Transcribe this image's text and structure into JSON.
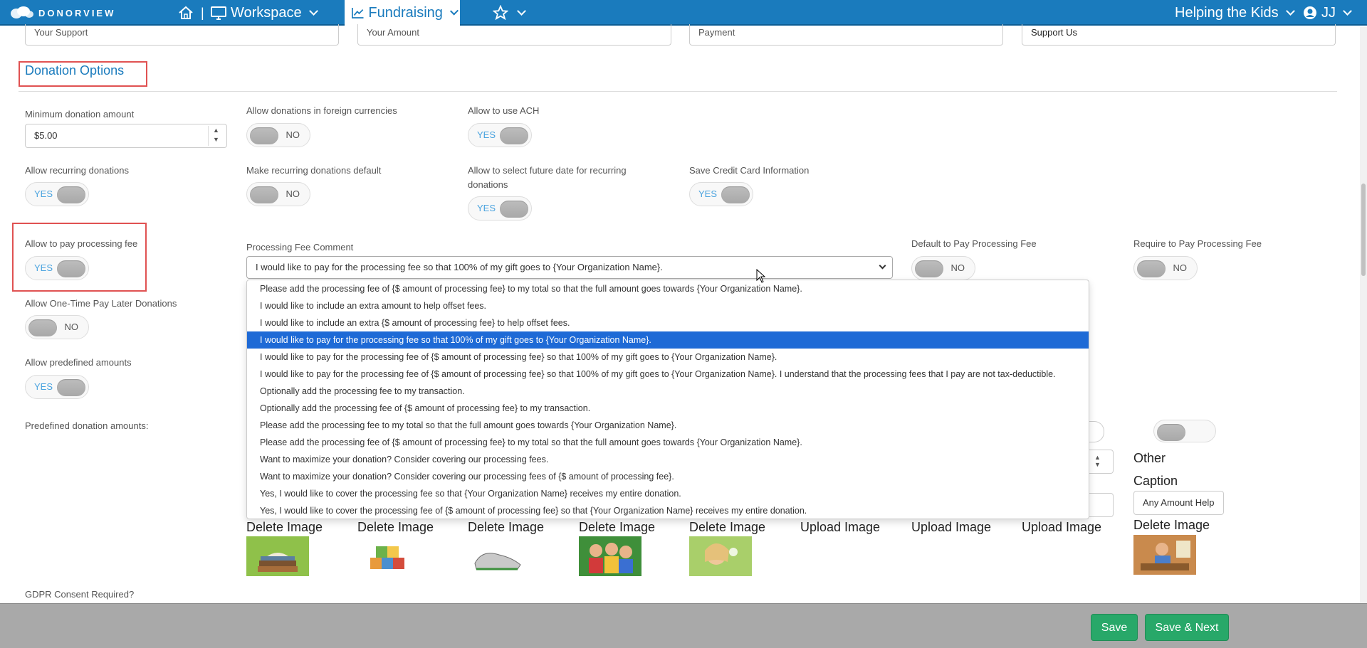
{
  "topbar": {
    "logo": "DONORVIEW",
    "nav_sep": "|",
    "workspace": "Workspace",
    "fundraising": "Fundraising",
    "org": "Helping the Kids",
    "user": "JJ"
  },
  "top_fields": [
    "Your Support",
    "Your Amount",
    "Payment",
    "Support Us"
  ],
  "section_title": "Donation Options",
  "fields": {
    "min_amount_label": "Minimum donation amount",
    "min_amount_value": "$5.00",
    "foreign_currency_label": "Allow donations in foreign currencies",
    "ach_label": "Allow to use ACH",
    "recurring_label": "Allow recurring donations",
    "recurring_default_label": "Make recurring donations default",
    "future_date_label": "Allow to select future date for recurring donations",
    "save_cc_label": "Save Credit Card Information",
    "processing_fee_label": "Allow to pay processing fee",
    "fee_comment_label": "Processing Fee Comment",
    "default_fee_label": "Default to Pay Processing Fee",
    "require_fee_label": "Require to Pay Processing Fee",
    "pay_later_label": "Allow One-Time Pay Later Donations",
    "predefined_label": "Allow predefined amounts",
    "predefined_amounts_label": "Predefined donation amounts:",
    "gdpr_label": "GDPR Consent Required?"
  },
  "toggles": {
    "yes": "YES",
    "no": "NO"
  },
  "fee_comment_selected": "I would like to pay for the processing fee so that 100% of my gift goes to {Your Organization Name}.",
  "fee_options": [
    "Please add the processing fee of {$ amount of processing fee} to my total so that the full amount goes towards {Your Organization Name}.",
    "I would like to include an extra amount to help offset fees.",
    "I would like to include an extra {$ amount of processing fee} to help offset fees.",
    "I would like to pay for the processing fee so that 100% of my gift goes to {Your Organization Name}.",
    "I would like to pay for the processing fee of {$ amount of processing fee} so that 100% of my gift goes to {Your Organization Name}.",
    "I would like to pay for the processing fee of {$ amount of processing fee} so that 100% of my gift goes to {Your Organization Name}. I understand that the processing fees that I pay are not tax-deductible.",
    "Optionally add the processing fee to my transaction.",
    "Optionally add the processing fee of {$ amount of processing fee} to my transaction.",
    "Please add the processing fee to my total so that the full amount goes towards {Your Organization Name}.",
    "Please add the processing fee of {$ amount of processing fee} to my total so that the full amount goes towards {Your Organization Name}.",
    "Want to maximize your donation? Consider covering our processing fees.",
    "Want to maximize your donation? Consider covering our processing fees of {$ amount of processing fee}.",
    "Yes, I would like to cover the processing fee so that {Your Organization Name} receives my entire donation.",
    "Yes, I would like to cover the processing fee of {$ amount of processing fee} so that {Your Organization Name} receives my entire donation."
  ],
  "other_column": {
    "other": "Other",
    "caption": "Caption",
    "caption_value": "Any Amount Help"
  },
  "image_actions": [
    "Delete Image",
    "Delete Image",
    "Delete Image",
    "Delete Image",
    "Delete Image",
    "Upload Image",
    "Upload Image",
    "Upload Image",
    "Delete Image"
  ],
  "footer": {
    "save": "Save",
    "save_next": "Save & Next"
  },
  "colors": {
    "brand": "#1a7bbd",
    "highlight": "#1e6ad6",
    "success": "#28a869",
    "annotation": "#e05252"
  }
}
